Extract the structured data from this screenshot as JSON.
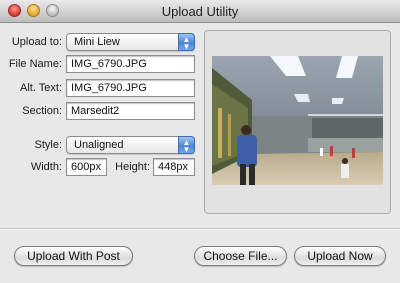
{
  "window": {
    "title": "Upload Utility"
  },
  "form": {
    "upload_to_label": "Upload to:",
    "upload_to_value": "Mini Liew",
    "file_name_label": "File Name:",
    "file_name_value": "IMG_6790.JPG",
    "alt_text_label": "Alt. Text:",
    "alt_text_value": "IMG_6790.JPG",
    "section_label": "Section:",
    "section_value": "Marsedit2",
    "style_label": "Style:",
    "style_value": "Unaligned",
    "width_label": "Width:",
    "width_value": "600px",
    "height_label": "Height:",
    "height_value": "448px"
  },
  "buttons": {
    "upload_with_post": "Upload With Post",
    "choose_file": "Choose File...",
    "upload_now": "Upload Now"
  },
  "icons": {
    "close": "close-icon",
    "minimize": "minimize-icon",
    "zoom": "zoom-icon",
    "popup_arrows": "updown-arrows-icon"
  },
  "colors": {
    "accent": "#4c86d6",
    "close": "#d0392b",
    "minimize": "#e2a422",
    "window_bg": "#e8e8e8"
  }
}
